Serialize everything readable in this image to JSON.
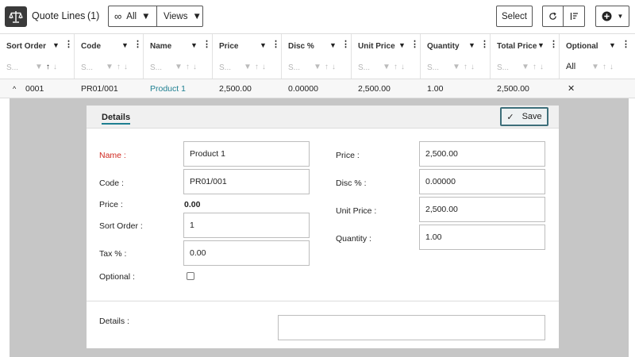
{
  "toolbar": {
    "title": "Quote Lines",
    "count": "(1)",
    "filter_label": "All",
    "views_label": "Views",
    "select_label": "Select"
  },
  "columns": [
    {
      "title": "Sort Order",
      "filter_placeholder": "S..."
    },
    {
      "title": "Code",
      "filter_placeholder": "S..."
    },
    {
      "title": "Name",
      "filter_placeholder": "S..."
    },
    {
      "title": "Price",
      "filter_placeholder": "S..."
    },
    {
      "title": "Disc %",
      "filter_placeholder": "S..."
    },
    {
      "title": "Unit Price",
      "filter_placeholder": "S..."
    },
    {
      "title": "Quantity",
      "filter_placeholder": "S..."
    },
    {
      "title": "Total Price",
      "filter_placeholder": "S..."
    },
    {
      "title": "Optional",
      "filter_value": "All"
    }
  ],
  "row": {
    "sort_order": "0001",
    "code": "PR01/001",
    "name": "Product 1",
    "price": "2,500.00",
    "disc": "0.00000",
    "unit_price": "2,500.00",
    "quantity": "1.00",
    "total_price": "2,500.00",
    "optional": "✕"
  },
  "details": {
    "tab_label": "Details",
    "save_label": "Save",
    "left": {
      "name_label": "Name :",
      "name_value": "Product 1",
      "code_label": "Code :",
      "code_value": "PR01/001",
      "price_label": "Price :",
      "price_value": "0.00",
      "sort_label": "Sort Order :",
      "sort_value": "1",
      "tax_label": "Tax % :",
      "tax_value": "0.00",
      "optional_label": "Optional :"
    },
    "right": {
      "price_label": "Price :",
      "price_value": "2,500.00",
      "disc_label": "Disc % :",
      "disc_value": "0.00000",
      "unit_label": "Unit Price :",
      "unit_value": "2,500.00",
      "qty_label": "Quantity :",
      "qty_value": "1.00"
    },
    "details_label": "Details :",
    "details_value": ""
  },
  "icons": {
    "app": "scales-icon",
    "infinity": "infinity-icon",
    "refresh": "refresh-icon",
    "sort": "sort-icon",
    "add": "plus-circle-icon"
  },
  "colors": {
    "accent": "#1e7f91",
    "required": "#d0281f",
    "detail_bg": "#c6c6c6"
  }
}
